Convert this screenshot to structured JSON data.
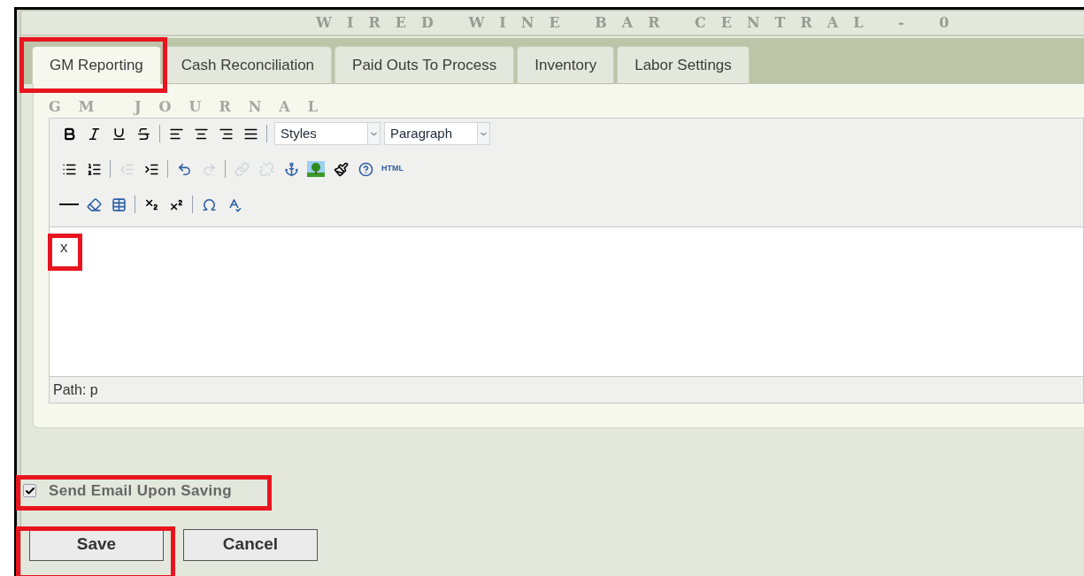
{
  "header": {
    "title": "WIRED WINE BAR CENTRAL - 0"
  },
  "tabs": [
    {
      "label": "GM Reporting",
      "selected": true
    },
    {
      "label": "Cash Reconciliation",
      "selected": false
    },
    {
      "label": "Paid Outs To Process",
      "selected": false
    },
    {
      "label": "Inventory",
      "selected": false
    },
    {
      "label": "Labor Settings",
      "selected": false
    }
  ],
  "section_title": "GM JOURNAL",
  "toolbar_rows": [
    [
      {
        "kind": "bold",
        "disabled": false
      },
      {
        "kind": "italic",
        "disabled": false
      },
      {
        "kind": "underline",
        "disabled": false
      },
      {
        "kind": "strike",
        "disabled": false
      },
      {
        "kind": "separator"
      },
      {
        "kind": "align-left",
        "disabled": false
      },
      {
        "kind": "align-center",
        "disabled": false
      },
      {
        "kind": "align-right",
        "disabled": false
      },
      {
        "kind": "justify",
        "disabled": false
      },
      {
        "kind": "separator"
      },
      {
        "kind": "select",
        "value": "Styles"
      },
      {
        "kind": "select",
        "value": "Paragraph"
      }
    ],
    [
      {
        "kind": "bullets",
        "disabled": false
      },
      {
        "kind": "numbers",
        "disabled": false
      },
      {
        "kind": "separator"
      },
      {
        "kind": "outdent",
        "disabled": true
      },
      {
        "kind": "indent",
        "disabled": false
      },
      {
        "kind": "separator"
      },
      {
        "kind": "undo",
        "disabled": false
      },
      {
        "kind": "redo",
        "disabled": true
      },
      {
        "kind": "separator"
      },
      {
        "kind": "link",
        "disabled": true
      },
      {
        "kind": "unlink",
        "disabled": true
      },
      {
        "kind": "anchor",
        "disabled": false
      },
      {
        "kind": "image",
        "disabled": false
      },
      {
        "kind": "cleanup",
        "disabled": false
      },
      {
        "kind": "help",
        "disabled": false
      },
      {
        "kind": "html",
        "label": "HTML",
        "disabled": false
      }
    ],
    [
      {
        "kind": "rule",
        "disabled": false
      },
      {
        "kind": "eraser",
        "disabled": false
      },
      {
        "kind": "table",
        "disabled": false
      },
      {
        "kind": "separator"
      },
      {
        "kind": "subscript",
        "disabled": false
      },
      {
        "kind": "superscript",
        "disabled": false
      },
      {
        "kind": "separator"
      },
      {
        "kind": "charmap",
        "disabled": false
      },
      {
        "kind": "spellcheck",
        "disabled": false
      }
    ]
  ],
  "editor": {
    "content": "x",
    "path": "Path: p"
  },
  "send_email": {
    "label": "Send Email Upon Saving",
    "checked": true
  },
  "buttons": [
    "Save",
    "Cancel"
  ],
  "highlights": {
    "tab": true,
    "content": true,
    "checkbox": true,
    "save": true
  }
}
